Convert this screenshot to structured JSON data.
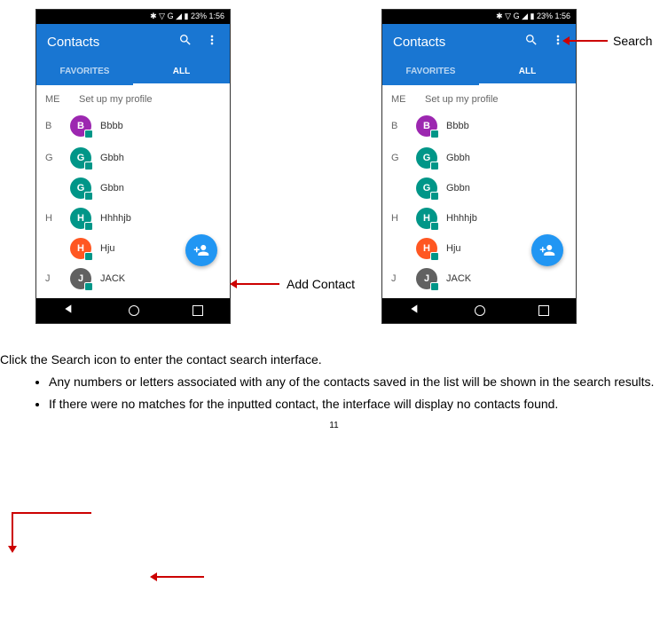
{
  "status_bar": "✱ ▽ G ◢ ▮ 23%  1:56",
  "app_title": "Contacts",
  "tabs": {
    "favorites": "FAVORITES",
    "all": "ALL"
  },
  "profile": {
    "letter": "ME",
    "text": "Set up my profile"
  },
  "sections": [
    {
      "letter": "B",
      "contacts": [
        {
          "initial": "B",
          "name": "Bbbb",
          "color": "#9C27B0"
        }
      ]
    },
    {
      "letter": "G",
      "contacts": [
        {
          "initial": "G",
          "name": "Gbbh",
          "color": "#009688"
        },
        {
          "initial": "G",
          "name": "Gbbn",
          "color": "#009688"
        }
      ]
    },
    {
      "letter": "H",
      "contacts": [
        {
          "initial": "H",
          "name": "Hhhhjb",
          "color": "#009688"
        },
        {
          "initial": "H",
          "name": "Hju",
          "color": "#FF5722"
        }
      ]
    },
    {
      "letter": "J",
      "contacts": [
        {
          "initial": "J",
          "name": "JACK",
          "color": "#616161"
        }
      ]
    }
  ],
  "annotations": {
    "add_contact": "Add Contact",
    "search": "Search"
  },
  "instructions": {
    "main": "Click the Search icon to enter the contact search interface.",
    "bullets": [
      "Any numbers or letters associated with any of the contacts saved in the list will be shown in the search results.",
      "If there were no matches for the inputted contact, the interface will display no contacts found."
    ]
  },
  "page_number": "11"
}
